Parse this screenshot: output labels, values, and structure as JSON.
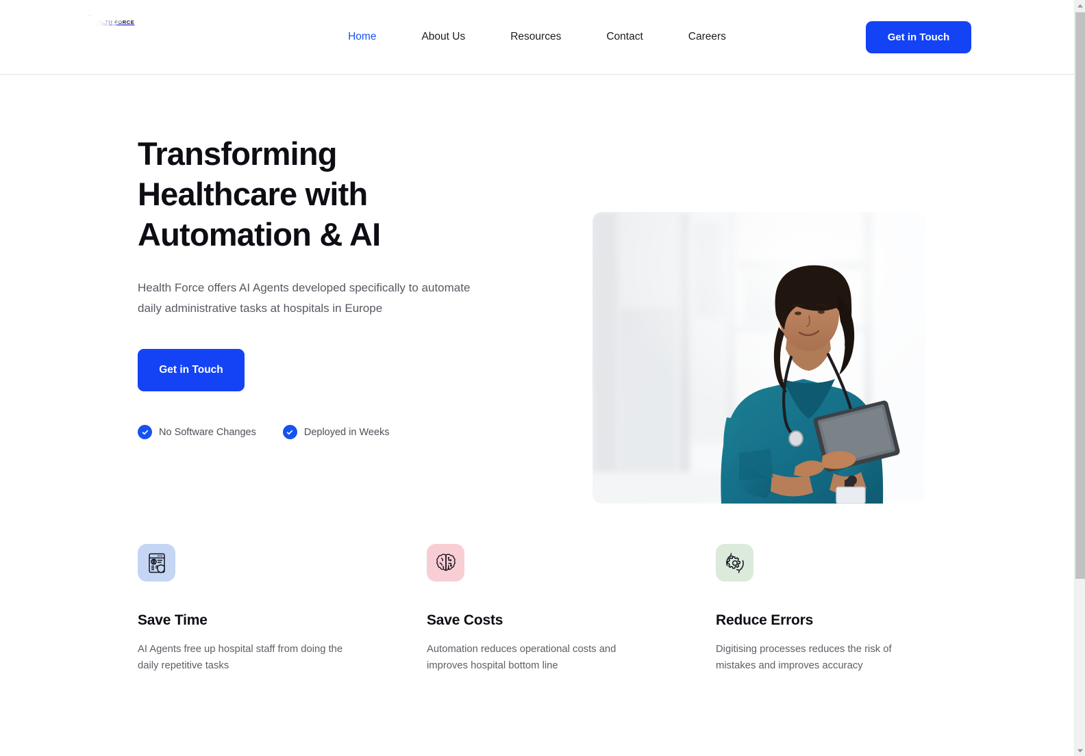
{
  "brand": {
    "logo_icon": "sunburst-logo-icon",
    "name": "HEALTH FORCE"
  },
  "header": {
    "nav": [
      {
        "label": "Home",
        "active": true
      },
      {
        "label": "About Us",
        "active": false
      },
      {
        "label": "Resources",
        "active": false
      },
      {
        "label": "Contact",
        "active": false
      },
      {
        "label": "Careers",
        "active": false
      }
    ],
    "cta_label": "Get in Touch"
  },
  "hero": {
    "title": "Transforming Healthcare with Automation & AI",
    "subtitle": "Health Force offers AI Agents developed specifically to automate daily administrative tasks at hospitals in Europe",
    "cta_label": "Get in Touch",
    "badges": [
      {
        "icon": "check-circle-icon",
        "label": "No Software Changes"
      },
      {
        "icon": "check-circle-icon",
        "label": "Deployed in Weeks"
      }
    ],
    "image_alt": "Nurse in teal scrubs with a stethoscope using a tablet in a bright hospital corridor"
  },
  "features": [
    {
      "icon": "document-profile-shield-icon",
      "icon_bg": "#c5d6f5",
      "title": "Save Time",
      "description": "AI Agents free up hospital staff from doing the daily repetitive tasks"
    },
    {
      "icon": "ai-brain-icon",
      "icon_bg": "#f9cdd4",
      "title": "Save Costs",
      "description": "Automation reduces operational costs and improves hospital bottom line"
    },
    {
      "icon": "gear-refresh-icon",
      "icon_bg": "#dceadb",
      "title": "Reduce Errors",
      "description": "Digitising processes reduces the risk of mistakes and improves accuracy"
    }
  ],
  "colors": {
    "accent_blue": "#1343f5",
    "nav_active": "#1652f0",
    "text_dark": "#0d0d14",
    "text_muted": "#5d5d66",
    "page_bg": "#ffffff"
  },
  "scrollbar": {
    "up_arrow": "scroll-up-arrow-icon",
    "down_arrow": "scroll-down-arrow-icon"
  }
}
